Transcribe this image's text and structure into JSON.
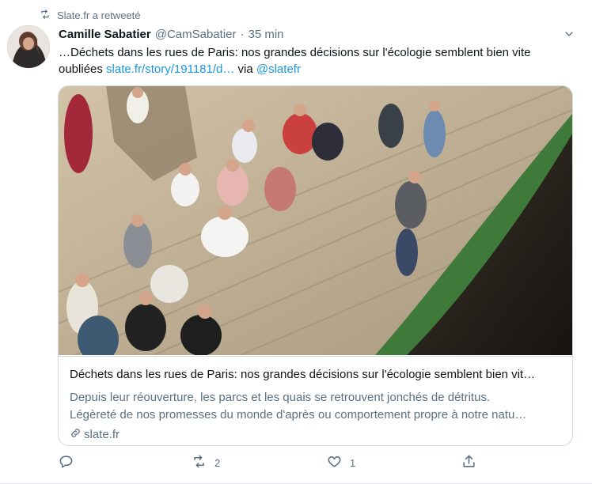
{
  "retweet": {
    "label": "Slate.fr a retweeté",
    "icon": "retweet-icon"
  },
  "author": {
    "name": "Camille Sabatier",
    "handle": "@CamSabatier",
    "separator": "·",
    "time": "35 min"
  },
  "tweet": {
    "text_lead": "…Déchets dans les rues de Paris: nos grandes décisions sur l'écologie semblent bien vite oubliées ",
    "link": "slate.fr/story/191181/d…",
    "via": " via ",
    "mention": "@slatefr"
  },
  "card": {
    "title": "Déchets dans les rues de Paris: nos grandes décisions sur l'écologie semblent bien vit…",
    "desc_line1": "Depuis leur réouverture, les parcs et les quais se retrouvent jonchés de détritus.",
    "desc_line2": "Légèreté de nos promesses du monde d'après ou comportement propre à notre natu…",
    "domain": "slate.fr",
    "image_subject": "people sitting on the quay steps by the Seine"
  },
  "actions": {
    "reply_count": "",
    "retweet_count": "2",
    "like_count": "1",
    "icons": [
      "reply-icon",
      "retweet-icon",
      "like-icon",
      "share-icon"
    ]
  },
  "colors": {
    "link": "#1b95e0",
    "secondary_text": "#5b7083",
    "border": "#cfd9de"
  }
}
